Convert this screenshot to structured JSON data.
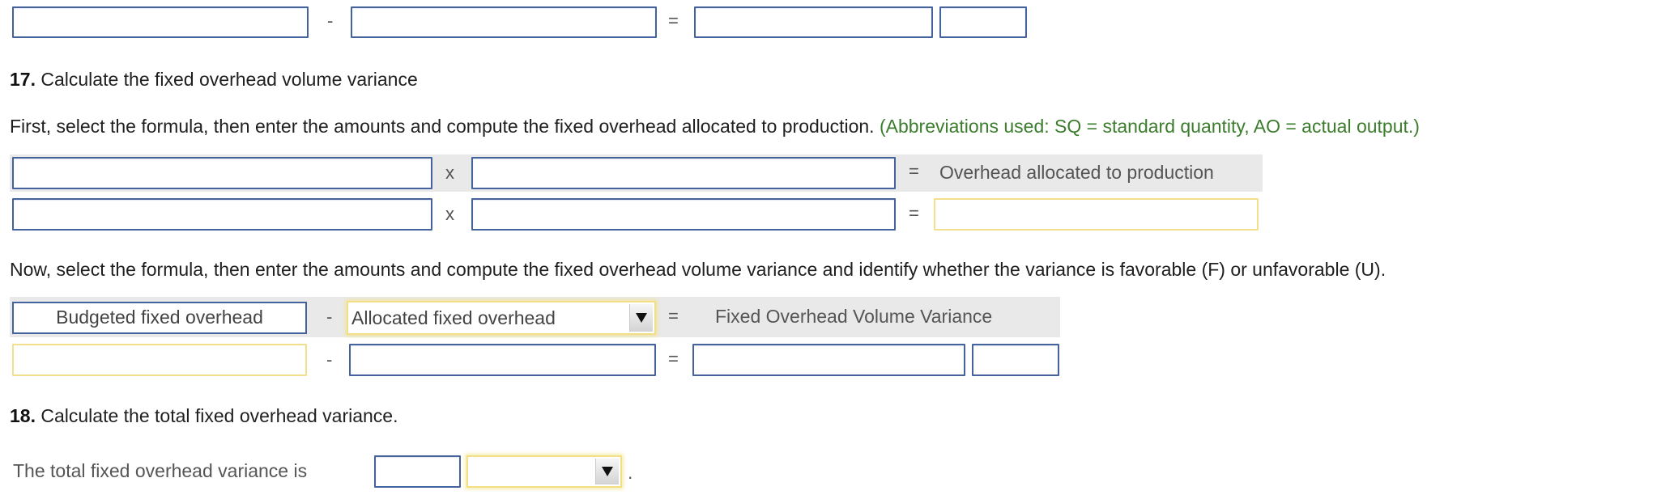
{
  "top_row": {
    "operator_minus": "-",
    "operator_equals": "=",
    "input1": "",
    "input2": "",
    "result": "",
    "fu": ""
  },
  "q17": {
    "number": "17.",
    "title": "Calculate the fixed overhead volume variance",
    "instruction1": "First, select the formula, then enter the amounts and compute the fixed overhead allocated to production.",
    "abbreviations": "(Abbreviations used: SQ = standard quantity, AO = actual output.)",
    "allocation": {
      "operator_times": "x",
      "operator_equals": "=",
      "formula_result_label": "Overhead allocated to production",
      "formula_input1": "",
      "formula_input2": "",
      "amount_input1": "",
      "amount_input2": "",
      "amount_result": ""
    },
    "instruction2": "Now, select the formula, then enter the amounts and compute the fixed overhead volume variance and identify whether the variance is favorable (F) or unfavorable (U).",
    "variance": {
      "formula_left_label": "Budgeted fixed overhead",
      "operator_minus": "-",
      "formula_select_value": "Allocated fixed overhead",
      "operator_equals": "=",
      "formula_result_label": "Fixed Overhead Volume Variance",
      "amount_input1": "",
      "amount_input2": "",
      "amount_result": "",
      "fu": ""
    }
  },
  "q18": {
    "number": "18.",
    "title": "Calculate the total fixed overhead variance.",
    "sentence_label": "The total fixed overhead variance is",
    "amount_input": "",
    "fu_select_value": "",
    "trailing_period": "."
  }
}
